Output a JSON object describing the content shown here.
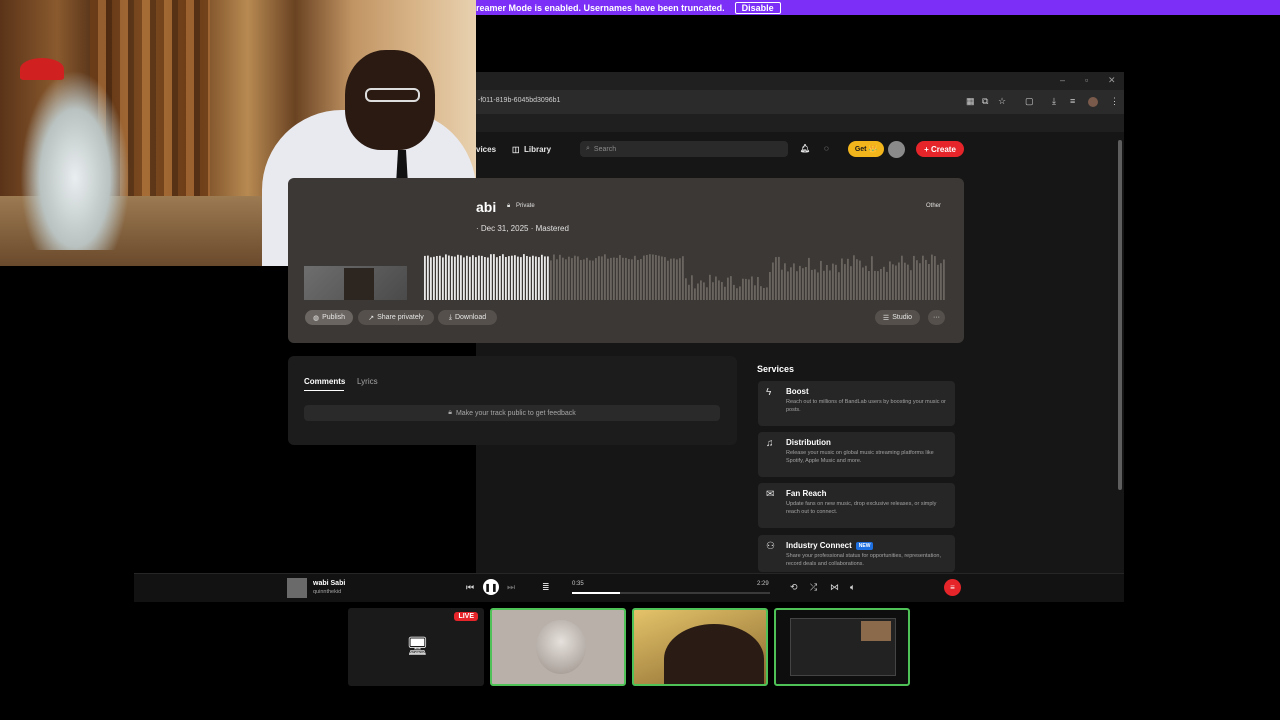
{
  "banner": {
    "message": "reamer Mode is enabled. Usernames have been truncated.",
    "disable_label": "Disable"
  },
  "browser": {
    "url": "-f011-819b-6045bd3096b1",
    "window_controls": [
      "–",
      "▫",
      "✕"
    ]
  },
  "nav": {
    "services_label": "vices",
    "library_label": "Library",
    "search_placeholder": "Search",
    "get_label": "Get 👑",
    "create_label": "+ Create"
  },
  "track": {
    "title": "abi",
    "visibility": "Private",
    "meta": "· Dec 31, 2025 · Mastered",
    "tag": "Other",
    "actions": {
      "publish": "Publish",
      "share": "Share privately",
      "download": "Download",
      "studio": "Studio",
      "more": "···"
    }
  },
  "comments": {
    "tabs": [
      "Comments",
      "Lyrics"
    ],
    "notice": "Make your track public to get feedback"
  },
  "services": {
    "heading": "Services",
    "items": [
      {
        "name": "Boost",
        "desc": "Reach out to millions of BandLab users by boosting your music or posts."
      },
      {
        "name": "Distribution",
        "desc": "Release your music on global music streaming platforms like Spotify, Apple Music and more."
      },
      {
        "name": "Fan Reach",
        "desc": "Update fans on new music, drop exclusive releases, or simply reach out to connect."
      },
      {
        "name": "Industry Connect",
        "badge": "NEW",
        "desc": "Share your professional status for opportunities, representation, record deals and collaborations."
      }
    ]
  },
  "player": {
    "track_title": "wabi Sabi",
    "artist": "quinnthekid",
    "elapsed": "0:35",
    "duration": "2:29",
    "progress_fraction": 0.24
  },
  "call": {
    "live_label": "LIVE"
  },
  "colors": {
    "accent_purple": "#7b2ff7",
    "create_red": "#e5252a",
    "get_gold": "#f2b51c",
    "tile_border_green": "#4ec257"
  }
}
